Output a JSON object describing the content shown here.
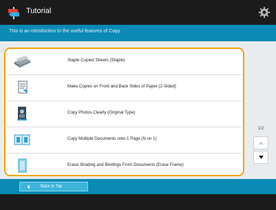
{
  "header": {
    "title": "Tutorial",
    "app_icon": "signpost-icon",
    "settings_icon": "gear-icon"
  },
  "info": {
    "text": "This is an introduction to the useful features of Copy."
  },
  "items": [
    {
      "label": "Staple Copied Sheets (Staple)",
      "icon": "stapler-icon"
    },
    {
      "label": "Make Copies on Front and Back Sides of Paper (2-Sided)",
      "icon": "two-sided-icon"
    },
    {
      "label": "Copy Photos Clearly (Original Type)",
      "icon": "photo-icon"
    },
    {
      "label": "Copy Multiple Documents onto 1 Page (N on 1)",
      "icon": "n-on-1-icon"
    },
    {
      "label": "Erase Shading and Bindings From Documents (Erase Frame)",
      "icon": "erase-frame-icon"
    }
  ],
  "pager": {
    "page": "1/2"
  },
  "footer": {
    "back_label": "Back to Top"
  },
  "colors": {
    "accent_blue": "#0a8ab5",
    "highlight_orange": "#f2a100",
    "header_dark": "#1b1b1b"
  }
}
